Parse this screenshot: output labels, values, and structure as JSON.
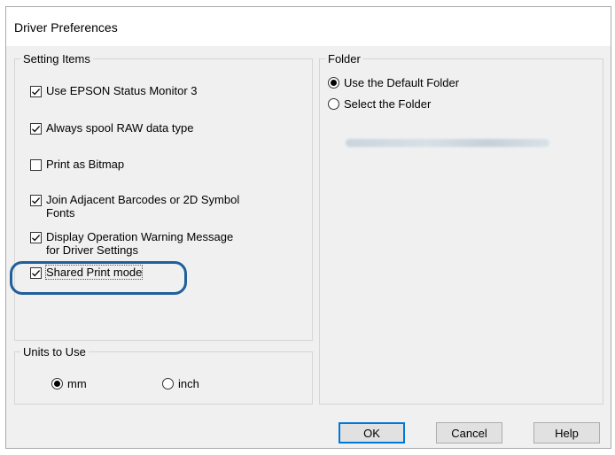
{
  "window": {
    "title": "Driver Preferences"
  },
  "setting_items": {
    "legend": "Setting Items",
    "items": [
      {
        "label": "Use EPSON Status Monitor 3",
        "checked": true
      },
      {
        "label": "Always spool RAW data type",
        "checked": true
      },
      {
        "label": "Print as Bitmap",
        "checked": false
      },
      {
        "label": "Join Adjacent Barcodes or 2D Symbol\nFonts",
        "checked": true
      },
      {
        "label": "Display Operation Warning Message\nfor Driver Settings",
        "checked": true
      },
      {
        "label": "Shared Print mode",
        "checked": true,
        "highlighted": true
      }
    ]
  },
  "units": {
    "legend": "Units to Use",
    "options": [
      {
        "label": "mm",
        "selected": true
      },
      {
        "label": "inch",
        "selected": false
      }
    ]
  },
  "folder": {
    "legend": "Folder",
    "options": [
      {
        "label": "Use the Default Folder",
        "selected": true
      },
      {
        "label": "Select the Folder",
        "selected": false
      }
    ]
  },
  "buttons": {
    "ok": "OK",
    "cancel": "Cancel",
    "help": "Help"
  },
  "colors": {
    "highlight_outline": "#1f5f9a",
    "default_button_border": "#0078d7"
  }
}
